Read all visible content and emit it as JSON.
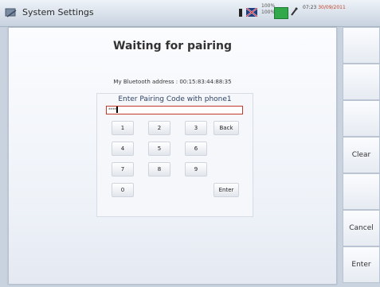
{
  "header": {
    "title": "System Settings",
    "battery_top": "100%",
    "battery_bottom": "100%",
    "time": "07:23",
    "date": "30/09/2011",
    "icons": [
      "settings-app-icon",
      "bluetooth-icon",
      "flag-icon",
      "battery-icon",
      "plug-icon"
    ]
  },
  "dialog": {
    "title": "Waiting for pairing",
    "address_label": "My Bluetooth address : 00:15:83:44:88:35",
    "prompt": "Enter Pairing Code with phone1",
    "code_value": "****",
    "keys": {
      "k1": "1",
      "k2": "2",
      "k3": "3",
      "back": "Back",
      "k4": "4",
      "k5": "5",
      "k6": "6",
      "k7": "7",
      "k8": "8",
      "k9": "9",
      "k0": "0",
      "enter": "Enter"
    }
  },
  "sidebar": {
    "clear": "Clear",
    "cancel": "Cancel",
    "enter": "Enter"
  },
  "colors": {
    "accent_border": "#c0392b",
    "prompt_text": "#2f4366",
    "battery": "#31a94a"
  }
}
